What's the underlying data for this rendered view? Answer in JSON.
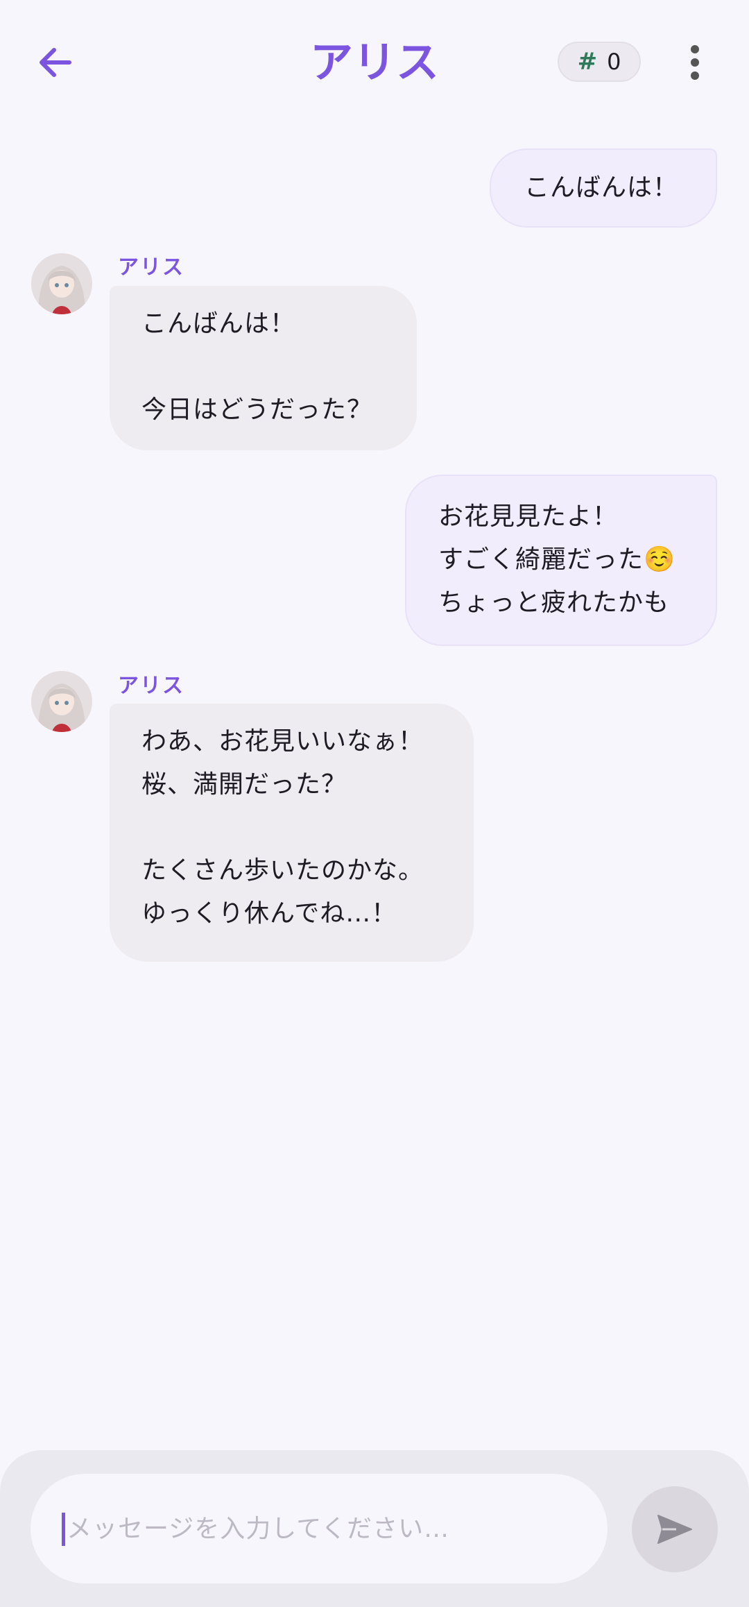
{
  "header": {
    "title": "アリス",
    "counter_symbol": "#",
    "counter_value": "0",
    "back_icon": "arrow-left-icon",
    "menu_icon": "more-vert-icon"
  },
  "messages": [
    {
      "role": "user",
      "lines": [
        "こんばんは！"
      ]
    },
    {
      "role": "assistant",
      "sender": "アリス",
      "lines": [
        "こんばんは！",
        "",
        "今日はどうだった？"
      ]
    },
    {
      "role": "user",
      "lines": [
        "お花見見たよ！",
        "すごく綺麗だった☺️",
        "ちょっと疲れたかも"
      ]
    },
    {
      "role": "assistant",
      "sender": "アリス",
      "lines": [
        "わあ、お花見いいなぁ！",
        "桜、満開だった？",
        "",
        "たくさん歩いたのかな。",
        "ゆっくり休んでね…！"
      ]
    }
  ],
  "input": {
    "placeholder": "メッセージを入力してください…",
    "send_icon": "send-icon"
  },
  "colors": {
    "accent": "#7b55e0",
    "user_bubble": "#f1edfc",
    "bot_bubble": "#eeebf1",
    "background": "#f8f6fd"
  }
}
